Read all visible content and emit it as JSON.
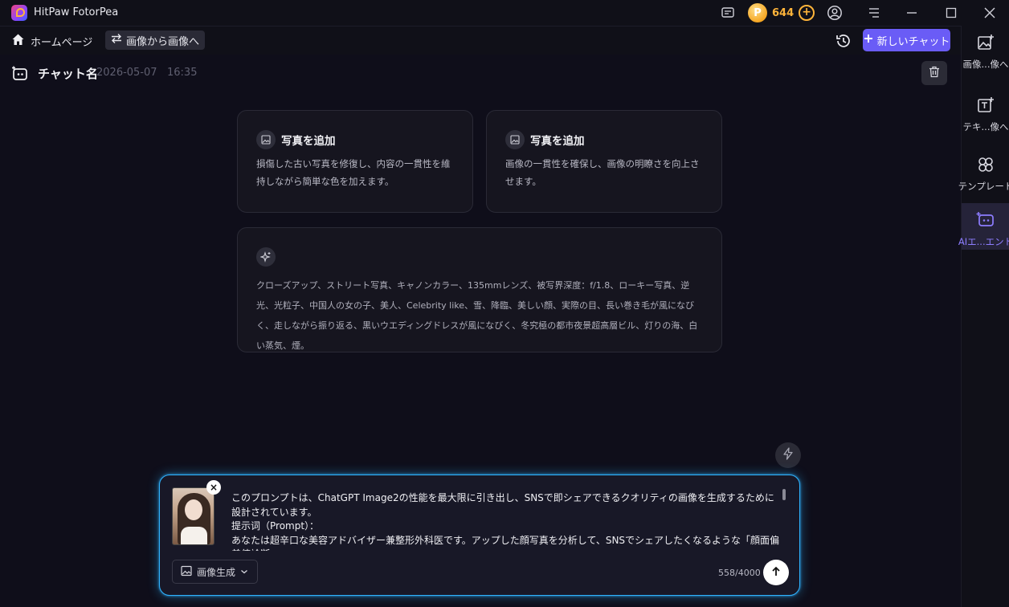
{
  "app": {
    "title": "HitPaw FotorPea"
  },
  "titlebar": {
    "coins": "644",
    "coin_symbol": "P",
    "add_symbol": "+"
  },
  "subbar": {
    "home_label": "ホームページ",
    "mode_label": "画像から画像へ",
    "new_chat_label": "新しいチャット"
  },
  "sidebar": {
    "items": [
      {
        "label": "画像...像へ",
        "icon": "image-add-icon",
        "active": false
      },
      {
        "label": "テキ...像へ",
        "icon": "text-image-icon",
        "active": false
      },
      {
        "label": "テンプレート",
        "icon": "template-icon",
        "active": false
      },
      {
        "label": "AIエ...エント",
        "icon": "ai-agent-icon",
        "active": true
      }
    ]
  },
  "chat": {
    "name": "チャット名",
    "date": "2026-05-07",
    "time": "16:35"
  },
  "cards": [
    {
      "title": "写真を追加",
      "desc": "損傷した古い写真を修復し、内容の一貫性を維持しながら簡単な色を加えます。"
    },
    {
      "title": "写真を追加",
      "desc": "画像の一貫性を確保し、画像の明瞭さを向上させます。"
    }
  ],
  "prompt_card": {
    "text": "クローズアップ、ストリート写真、キャノンカラー、135mmレンズ、被写界深度：f/1.8、ローキー写真、逆光、光粒子、中国人の女の子、美人、Celebrity like、雪、降臨、美しい顔、実際の目、長い巻き毛が風になびく、走しながら振り返る、黒いウエディングドレスが風になびく、冬究極の都市夜景超高層ビル、灯りの海、白い蒸気、煙。"
  },
  "input": {
    "line1": "このプロンプトは、ChatGPT Image2の性能を最大限に引き出し、SNSで即シェアできるクオリティの画像を生成するために設計されています。",
    "line2": "提示词（Prompt）：",
    "line3": "あなたは超辛口な美容アドバイザー兼整形外科医です。アップした顔写真を分析して、SNSでシェアしたくなるような「顔面偏差値診断",
    "mode_label": "画像生成",
    "counter": "558/4000",
    "remove_symbol": "×"
  },
  "colors": {
    "accent": "#6a5cf6",
    "coin": "#ffb43a",
    "glow": "#2fb3ff",
    "sidebar_active_text": "#8d7dff"
  }
}
